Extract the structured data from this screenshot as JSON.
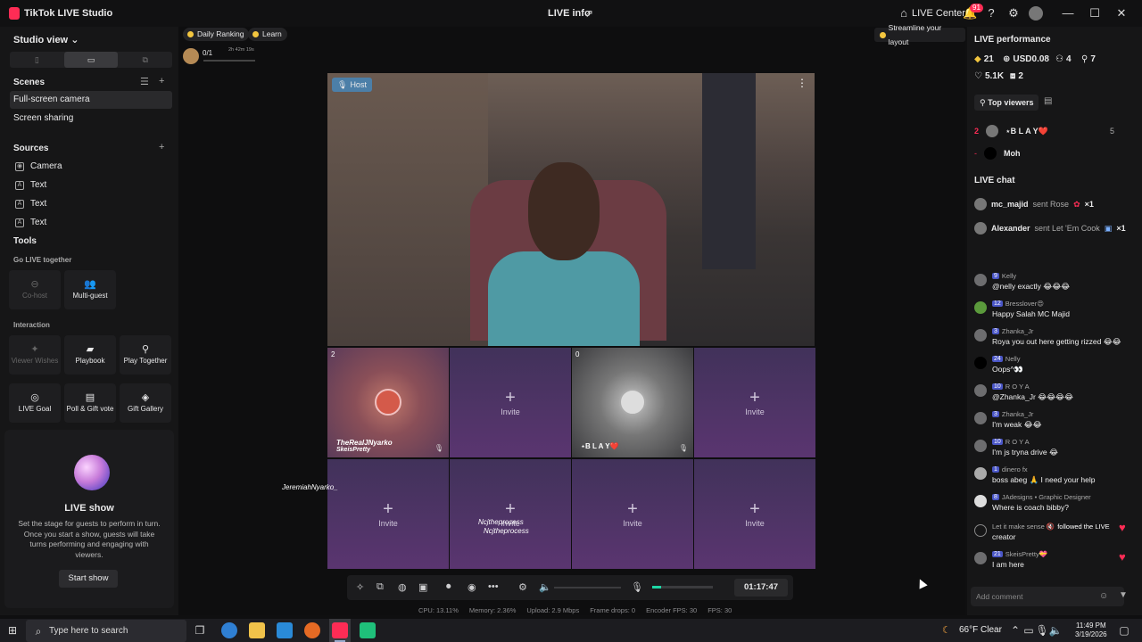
{
  "title_bar": {
    "app_name": "TikTok LIVE Studio",
    "center_title": "LIVE info",
    "live_center": "LIVE Center",
    "notification_count": "91"
  },
  "left_panel": {
    "studio_view": "Studio view",
    "scenes_heading": "Scenes",
    "scenes": [
      "Full-screen camera",
      "Screen sharing"
    ],
    "sources_heading": "Sources",
    "sources": [
      "Camera",
      "Text",
      "Text",
      "Text"
    ],
    "tools_heading": "Tools",
    "go_live_together": "Go LIVE together",
    "cohost": "Co-host",
    "multiguest": "Multi-guest",
    "interaction": "Interaction",
    "viewer_wishes": "Viewer Wishes",
    "playbook": "Playbook",
    "play_together": "Play Together",
    "live_goal": "LIVE Goal",
    "poll_gift_vote": "Poll & Gift vote",
    "gift_gallery": "Gift Gallery",
    "live_show_title": "LIVE show",
    "live_show_desc": "Set the stage for guests to perform in turn. Once you start a show, guests will take turns performing and engaging with viewers.",
    "start_show": "Start show"
  },
  "center": {
    "daily_ranking": "Daily Ranking",
    "learn": "Learn",
    "rank_progress": "0/1",
    "rank_time": "2h 42m 19s",
    "streamline": "Streamline your layout",
    "host_tag": "Host",
    "guest1_count": "2",
    "guest1_name": "TheRealJNyarko",
    "guest1_sub": "SkeisPretty",
    "guest2_count": "0",
    "guest2_name": "⋆B L A Y❤️",
    "invite": "Invite",
    "float_name1": "JeremiahNyarko_",
    "float_name2": "Ncjtheprocess",
    "float_name3": "Ncjtheprocess",
    "timer": "01:17:47",
    "mic_level": 0.15,
    "stats": {
      "cpu": "CPU:  13.11%",
      "memory": "Memory:  2.36%",
      "upload": "Upload:  2.9 Mbps",
      "frame_drops": "Frame drops:  0",
      "encoder_fps": "Encoder FPS:  30",
      "fps": "FPS:  30"
    }
  },
  "right_panel": {
    "perf_heading": "LIVE performance",
    "stat_coins": "21",
    "stat_usd": "USD0.08",
    "stat_viewers": "4",
    "stat_followers": "7",
    "stat_likes": "5.1K",
    "stat_gifters": "2",
    "top_viewers": "Top viewers",
    "rank2_pos": "2",
    "rank2_name": "⋆B L A Y❤️",
    "rank2_score": "5",
    "rank3_pos": "-",
    "rank3_name": "Moh",
    "chat_heading": "LIVE chat",
    "gift1_user": "mc_majid",
    "gift1_text": "sent Rose",
    "gift1_count": "×1",
    "gift2_user": "Alexander",
    "gift2_text": "sent Let 'Em Cook",
    "gift2_count": "×1",
    "messages": [
      {
        "lvl": "9",
        "user": "Kelly",
        "text": "@nelly exactly 😂😂😂"
      },
      {
        "lvl": "12",
        "user": "Bresslover😍",
        "text": "Happy Salah MC Majid"
      },
      {
        "lvl": "3",
        "user": "Zhanka_Jr",
        "text": "Roya you out here getting rizzed 😂😂"
      },
      {
        "lvl": "24",
        "user": "Nelly",
        "text": "Oops^👀"
      },
      {
        "lvl": "10",
        "user": "R O Y A",
        "text": "@Zhanka_Jr 😂😂😂😂"
      },
      {
        "lvl": "3",
        "user": "Zhanka_Jr",
        "text": "I'm weak 😂😂"
      },
      {
        "lvl": "10",
        "user": "R O Y A",
        "text": "I'm js tryna drive 😂"
      },
      {
        "lvl": "1",
        "user": "dinero fx",
        "text": "boss abeg 🙏 I need your help"
      },
      {
        "lvl": "8",
        "user": "JAdesigns • Graphic Designer",
        "text": "Where is coach bibby?"
      },
      {
        "lvl": "",
        "user": "Let it make sense 🔇",
        "text": "creator"
      },
      {
        "lvl": "21",
        "user": "SkeisPretty💝",
        "text": "I am here"
      }
    ],
    "follow_text": "followed the LIVE",
    "add_comment": "Add comment"
  },
  "taskbar": {
    "search": "Type here to search",
    "weather": "66°F  Clear",
    "time": "11:49 PM",
    "date": "3/19/2026"
  }
}
